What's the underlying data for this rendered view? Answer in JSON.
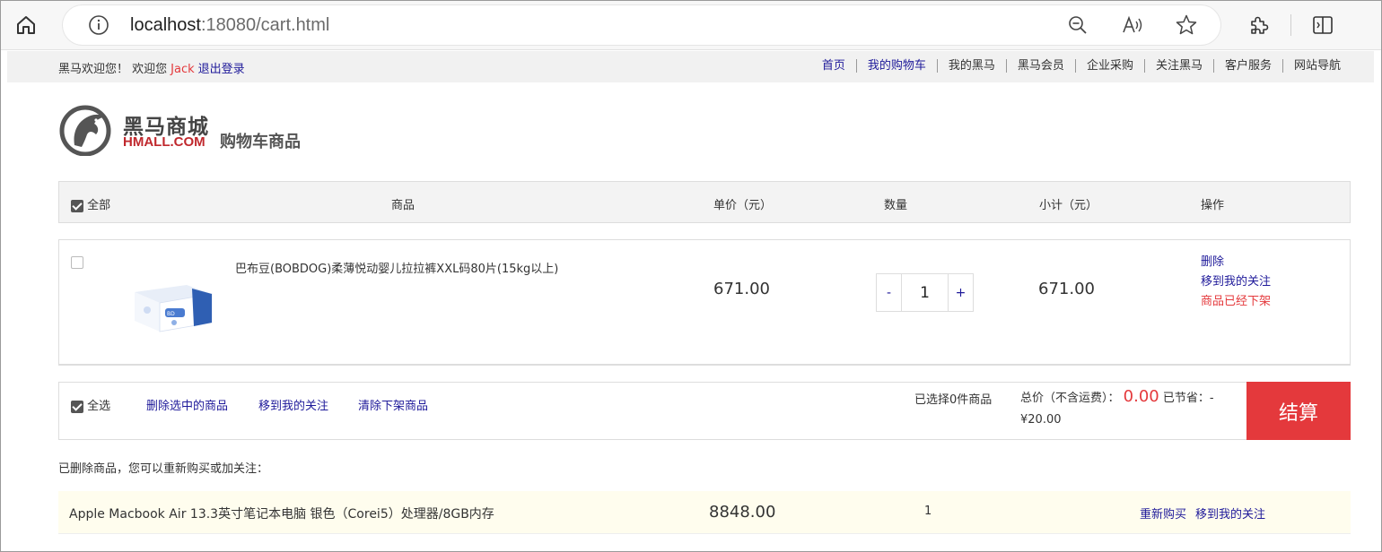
{
  "browser": {
    "url_host": "localhost",
    "url_rest": ":18080/cart.html"
  },
  "topnav": {
    "welcome": "黑马欢迎您！ 欢迎您",
    "user": "Jack",
    "logout": "退出登录",
    "links": [
      "首页",
      "我的购物车",
      "我的黑马",
      "黑马会员",
      "企业采购",
      "关注黑马",
      "客户服务",
      "网站导航"
    ]
  },
  "brand": {
    "cn": "黑马商城",
    "en": "HMALL.COM",
    "page_title": "购物车商品"
  },
  "cart_header": {
    "select_all": "全部",
    "product": "商品",
    "unit_price": "单价（元）",
    "quantity": "数量",
    "subtotal": "小计（元）",
    "actions": "操作"
  },
  "item": {
    "name": "巴布豆(BOBDOG)柔薄悦动婴儿拉拉裤XXL码80片(15kg以上)",
    "price": "671.00",
    "qty_minus": "-",
    "qty": "1",
    "qty_plus": "+",
    "subtotal": "671.00",
    "op_delete": "删除",
    "op_move": "移到我的关注",
    "op_status": "商品已经下架"
  },
  "summary": {
    "select_all": "全选",
    "delete_selected": "删除选中的商品",
    "move_to_follow": "移到我的关注",
    "clear_offshelf": "清除下架商品",
    "selected_count": "已选择0件商品",
    "total_label": "总价（不含运费）：",
    "total": "0.00",
    "saved_label": "已节省：-",
    "saved": "¥20.00",
    "checkout": "结算"
  },
  "deleted": {
    "title": "已删除商品，您可以重新购买或加关注：",
    "name": "Apple Macbook Air 13.3英寸笔记本电脑 银色（Corei5）处理器/8GB内存",
    "price": "8848.00",
    "qty": "1",
    "rebuy": "重新购买",
    "follow": "移到我的关注"
  },
  "colors": {
    "accent_red": "#e4393c",
    "link_blue": "#1f1a9a"
  }
}
